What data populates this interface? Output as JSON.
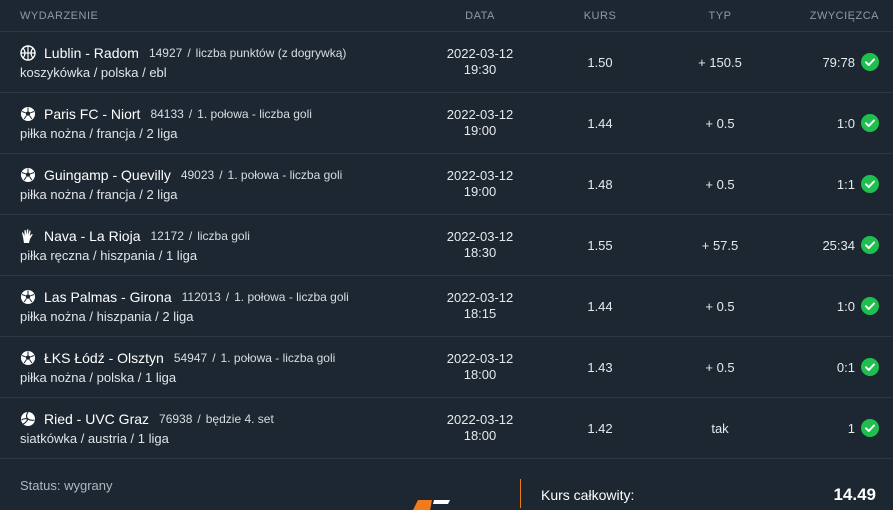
{
  "header": {
    "event": "WYDARZENIE",
    "date": "DATA",
    "kurs": "KURS",
    "typ": "TYP",
    "winner": "ZWYCIĘZCA"
  },
  "rows": [
    {
      "sport_icon": "basketball-icon",
      "match": "Lublin - Radom",
      "id": "14927",
      "market": "liczba punktów (z dogrywką)",
      "league": "koszykówka / polska / ebl",
      "date": "2022-03-12",
      "time": "19:30",
      "kurs": "1.50",
      "typ": "+ 150.5",
      "result": "79:78"
    },
    {
      "sport_icon": "football-icon",
      "match": "Paris FC - Niort",
      "id": "84133",
      "market": "1. połowa - liczba goli",
      "league": "piłka nożna / francja / 2 liga",
      "date": "2022-03-12",
      "time": "19:00",
      "kurs": "1.44",
      "typ": "+ 0.5",
      "result": "1:0"
    },
    {
      "sport_icon": "football-icon",
      "match": "Guingamp - Quevilly",
      "id": "49023",
      "market": "1. połowa - liczba goli",
      "league": "piłka nożna / francja / 2 liga",
      "date": "2022-03-12",
      "time": "19:00",
      "kurs": "1.48",
      "typ": "+ 0.5",
      "result": "1:1"
    },
    {
      "sport_icon": "handball-icon",
      "match": "Nava - La Rioja",
      "id": "12172",
      "market": "liczba goli",
      "league": "piłka ręczna / hiszpania / 1 liga",
      "date": "2022-03-12",
      "time": "18:30",
      "kurs": "1.55",
      "typ": "+ 57.5",
      "result": "25:34"
    },
    {
      "sport_icon": "football-icon",
      "match": "Las Palmas - Girona",
      "id": "112013",
      "market": "1. połowa - liczba goli",
      "league": "piłka nożna / hiszpania / 2 liga",
      "date": "2022-03-12",
      "time": "18:15",
      "kurs": "1.44",
      "typ": "+ 0.5",
      "result": "1:0"
    },
    {
      "sport_icon": "football-icon",
      "match": "ŁKS Łódź - Olsztyn",
      "id": "54947",
      "market": "1. połowa - liczba goli",
      "league": "piłka nożna / polska / 1 liga",
      "date": "2022-03-12",
      "time": "18:00",
      "kurs": "1.43",
      "typ": "+ 0.5",
      "result": "0:1"
    },
    {
      "sport_icon": "volleyball-icon",
      "match": "Ried - UVC Graz",
      "id": "76938",
      "market": "będzie 4. set",
      "league": "siatkówka / austria / 1 liga",
      "date": "2022-03-12",
      "time": "18:00",
      "kurs": "1.42",
      "typ": "tak",
      "result": "1"
    }
  ],
  "footer": {
    "status": "Status: wygrany",
    "total_label": "Kurs całkowity:",
    "total_value": "14.49"
  },
  "colors": {
    "background": "#1c2731",
    "check": "#1fbf4f",
    "accent": "#f07b1d"
  }
}
